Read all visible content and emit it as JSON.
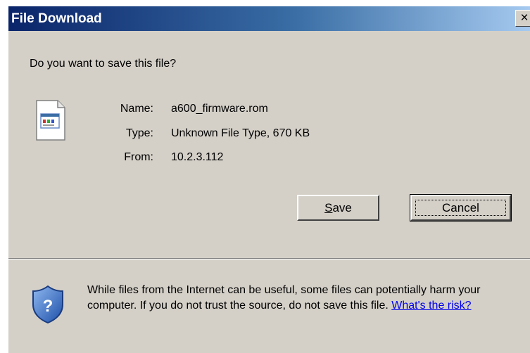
{
  "window": {
    "title": "File Download",
    "close_label": "×"
  },
  "prompt": "Do you want to save this file?",
  "file": {
    "icon": "unknown-file-icon",
    "name_label": "Name:",
    "name_value": "a600_firmware.rom",
    "type_label": "Type:",
    "type_value": "Unknown File Type, 670 KB",
    "from_label": "From:",
    "from_value": "10.2.3.112"
  },
  "buttons": {
    "save_label": "Save",
    "save_accesskey_char": "S",
    "save_rest": "ave",
    "cancel_label": "Cancel"
  },
  "warning": {
    "icon": "security-shield-icon",
    "text": "While files from the Internet can be useful, some files can potentially harm your computer. If you do not trust the source, do not save this file.",
    "link_label": "What's the risk?"
  },
  "colors": {
    "titlebar_start": "#0a246a",
    "titlebar_end": "#a6caf0",
    "dialog_bg": "#d4d0c8",
    "link": "#0000ee"
  }
}
